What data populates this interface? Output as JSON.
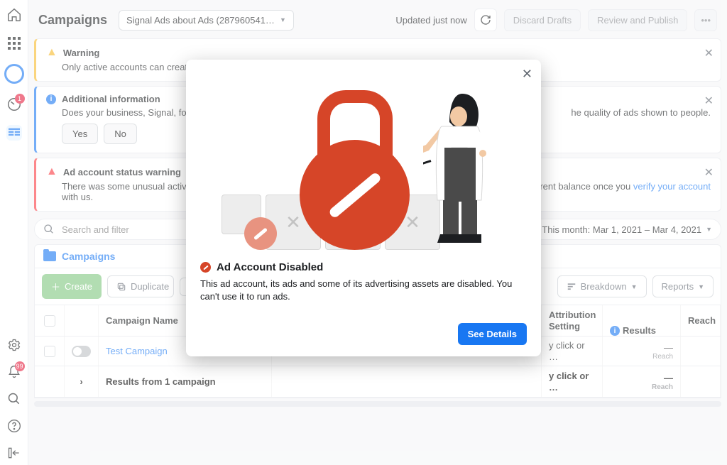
{
  "header": {
    "title": "Campaigns",
    "account_selector": "Signal Ads about Ads (287960541902…",
    "updated_text": "Updated just now",
    "discard": "Discard Drafts",
    "review": "Review and Publish"
  },
  "rail": {
    "notif_badge": "1"
  },
  "banners": {
    "warning": {
      "title": "Warning",
      "body": "Only active accounts can create or ed"
    },
    "info": {
      "title": "Additional information",
      "body_pre": "Does your business, Signal, focus on p",
      "body_post": "he quality of ads shown to people.",
      "yes": "Yes",
      "no": "No"
    },
    "error": {
      "title": "Ad account status warning",
      "body_pre": "There was some unusual activity on y",
      "body_post": "urrent balance once you ",
      "link": "verify your account",
      "body_after": " with us."
    }
  },
  "search": {
    "placeholder": "Search and filter",
    "daterange": "This month: Mar 1, 2021 – Mar 4, 2021"
  },
  "tabs": {
    "campaigns": "Campaigns"
  },
  "toolbar": {
    "create": "Create",
    "duplicate": "Duplicate",
    "breakdown": "Breakdown",
    "reports": "Reports"
  },
  "table": {
    "col_name": "Campaign Name",
    "col_attr": "Attribution Setting",
    "col_results": "Results",
    "col_reach": "Reach",
    "row": {
      "name": "Test Campaign",
      "attr": "y click or …",
      "res_val": "—",
      "res_sub": "Reach"
    },
    "summary": {
      "label": "Results from 1 campaign",
      "attr": "y click or …",
      "res_val": "—",
      "res_sub": "Reach"
    }
  },
  "modal": {
    "title": "Ad Account Disabled",
    "body": "This ad account, its ads and some of its advertising assets are disabled. You can't use it to run ads.",
    "cta": "See Details"
  }
}
